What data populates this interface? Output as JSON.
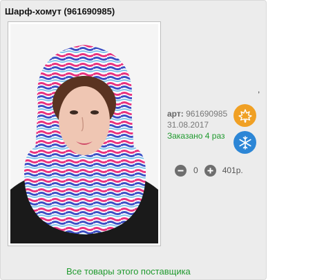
{
  "product": {
    "title": "Шарф-хомут (961690985)",
    "art_label": "арт:",
    "art_number": "961690985",
    "date": "31.08.2017",
    "ordered_text": "Заказано 4 раз",
    "season_icons": [
      "maple-leaf-icon",
      "snowflake-icon"
    ],
    "quantity": "0",
    "price": "401р."
  },
  "decor": {
    "tick": ","
  },
  "supplier_link": "Все товары этого поставщика",
  "colors": {
    "card_bg": "#ececec",
    "link_green": "#1f9a2e",
    "autumn_orange": "#f0a024",
    "winter_blue": "#2c86d6"
  }
}
